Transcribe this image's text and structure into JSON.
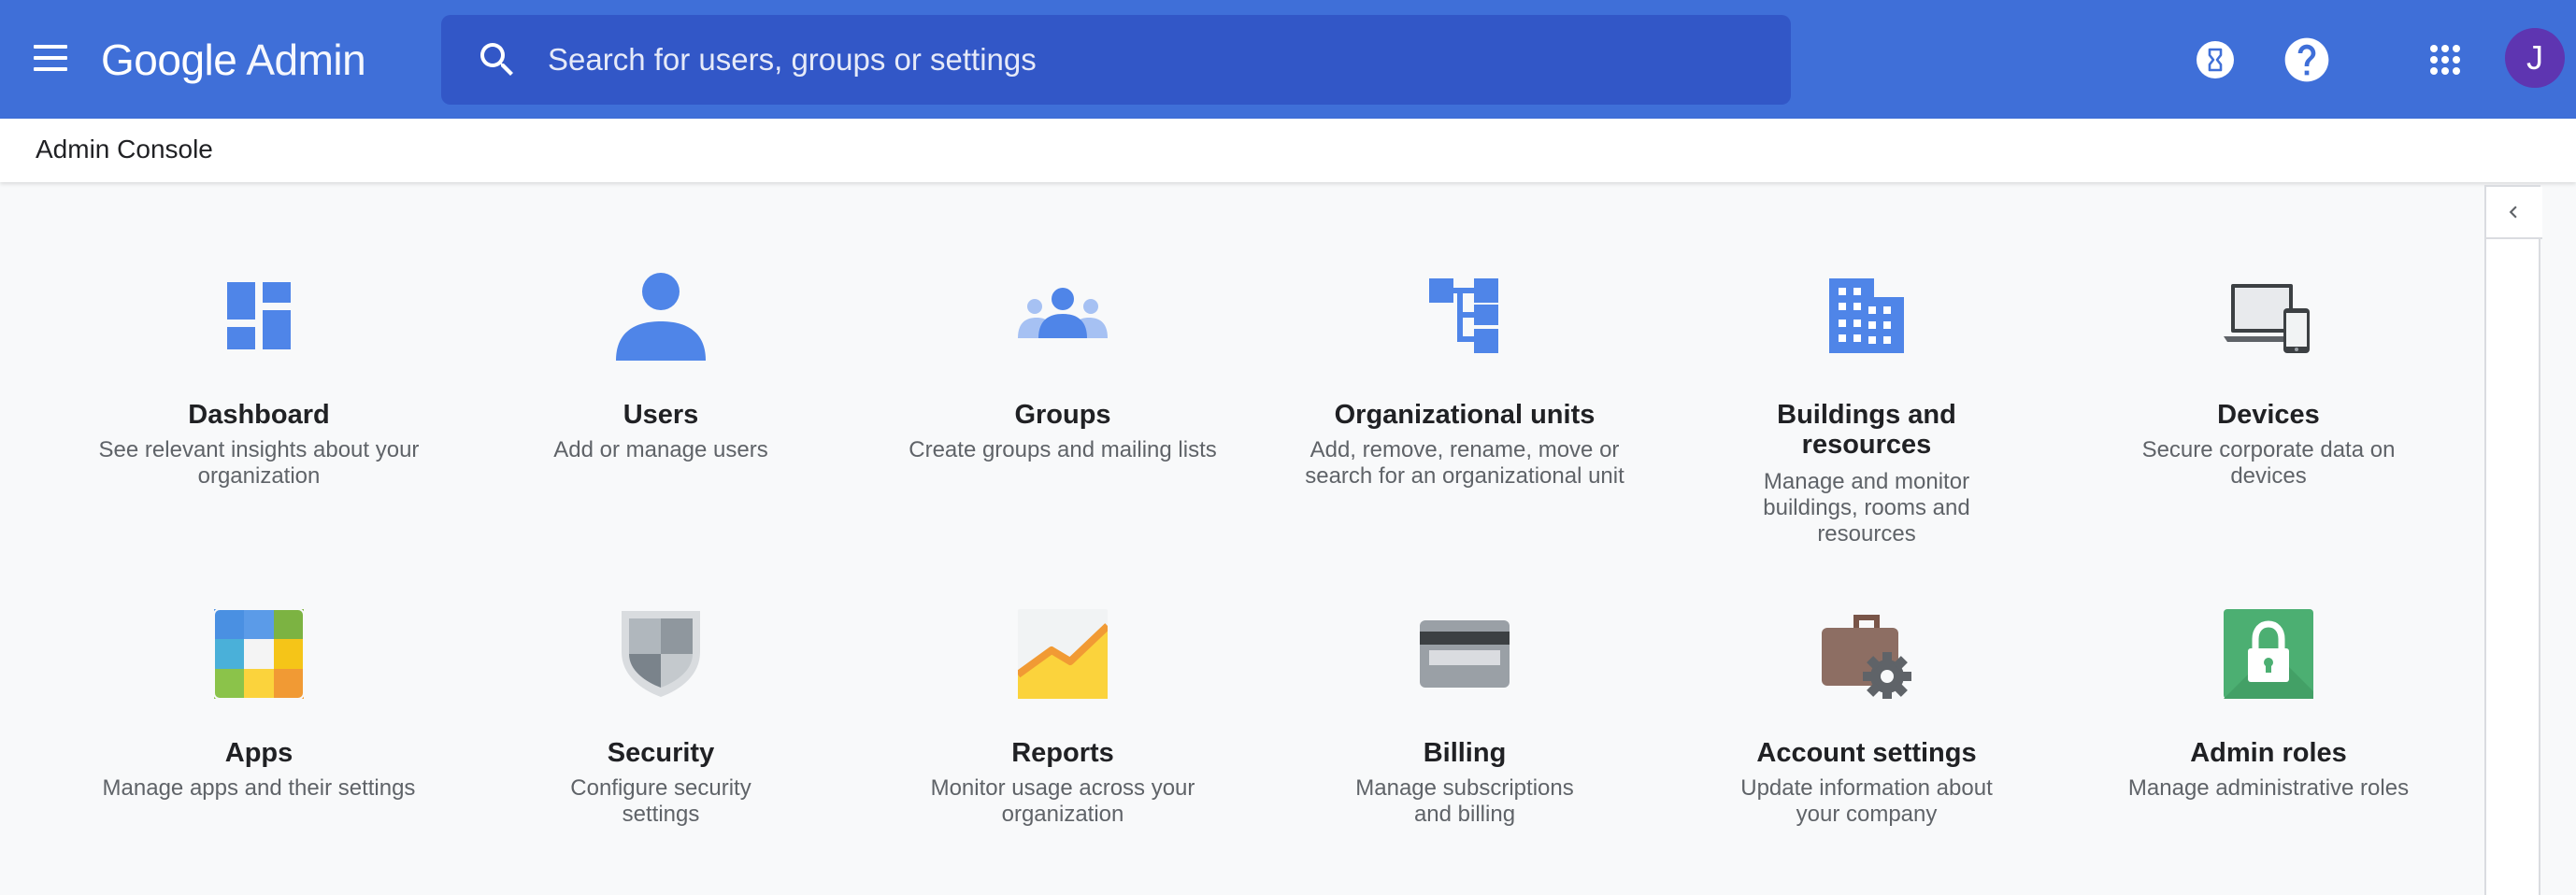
{
  "header": {
    "logo_primary": "Google",
    "logo_secondary": "Admin",
    "search_placeholder": "Search for users, groups or settings",
    "avatar_initial": "J"
  },
  "subbar": {
    "breadcrumb": "Admin Console"
  },
  "colors": {
    "topbar": "#3f6fd8",
    "search": "#3257c7",
    "accent_blue": "#4f85e8",
    "avatar": "#5e35b1"
  },
  "cards": [
    {
      "title": "Dashboard",
      "description": "See relevant insights about your organization",
      "icon": "dashboard-icon"
    },
    {
      "title": "Users",
      "description": "Add or manage users",
      "icon": "user-icon"
    },
    {
      "title": "Groups",
      "description": "Create groups and mailing lists",
      "icon": "groups-icon"
    },
    {
      "title": "Organizational units",
      "description": "Add, remove, rename, move or search for an organizational unit",
      "icon": "org-units-icon"
    },
    {
      "title": "Buildings and resources",
      "description": "Manage and monitor buildings, rooms and resources",
      "icon": "building-icon"
    },
    {
      "title": "Devices",
      "description": "Secure corporate data on devices",
      "icon": "devices-icon"
    },
    {
      "title": "Apps",
      "description": "Manage apps and their settings",
      "icon": "apps-icon"
    },
    {
      "title": "Security",
      "description": "Configure security settings",
      "icon": "shield-icon"
    },
    {
      "title": "Reports",
      "description": "Monitor usage across your organization",
      "icon": "reports-chart-icon"
    },
    {
      "title": "Billing",
      "description": "Manage subscriptions and billing",
      "icon": "credit-card-icon"
    },
    {
      "title": "Account settings",
      "description": "Update information about your company",
      "icon": "briefcase-gear-icon"
    },
    {
      "title": "Admin roles",
      "description": "Manage administrative roles",
      "icon": "lock-icon"
    }
  ]
}
